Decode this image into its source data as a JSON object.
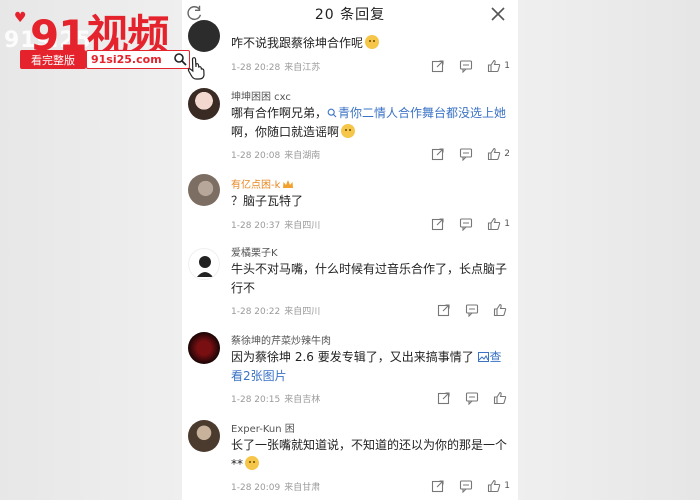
{
  "header": {
    "title": "20 条回复"
  },
  "comments": [
    {
      "name": "",
      "text": "咋不说我跟蔡徐坤合作呢",
      "date": "1-28 20:28",
      "location": "来自江苏",
      "likes": "1",
      "emoji": true
    },
    {
      "name": "坤坤困困 cxc",
      "text_before": "哪有合作啊兄弟，",
      "search_chip": "青你二情人合作舞台都没选上她",
      "text_after": "啊，你随口就造谣啊",
      "date": "1-28 20:08",
      "location": "来自湖南",
      "likes": "2",
      "emoji": true
    },
    {
      "name": "有亿点困-k",
      "text": "？脑子瓦特了",
      "date": "1-28 20:37",
      "location": "来自四川",
      "likes": "1"
    },
    {
      "name": "爱橘栗子K",
      "text": "牛头不对马嘴，什么时候有过音乐合作了，长点脑子行不",
      "date": "1-28 20:22",
      "location": "来自四川",
      "likes": ""
    },
    {
      "name": "蔡徐坤的芹菜炒辣牛肉",
      "text": "因为蔡徐坤 2.6 要发专辑了，又出来搞事情了",
      "link_text": "查看2张图片",
      "date": "1-28 20:15",
      "location": "来自吉林",
      "likes": ""
    },
    {
      "name": "Exper-Kun 困",
      "text": "长了一张嘴就知道说，不知道的还以为你的那是一个**",
      "date": "1-28 20:09",
      "location": "来自甘肃",
      "likes": "1",
      "emoji": true
    }
  ],
  "watermark": {
    "big": "91视频",
    "ghost": "91si25",
    "badge": "看完整版",
    "url": "91si25.com",
    "brand_color": "#e5232d"
  },
  "icons": [
    "refresh-icon",
    "close-icon",
    "share-icon",
    "reply-icon",
    "like-icon",
    "search-icon",
    "hand-cursor-icon"
  ]
}
